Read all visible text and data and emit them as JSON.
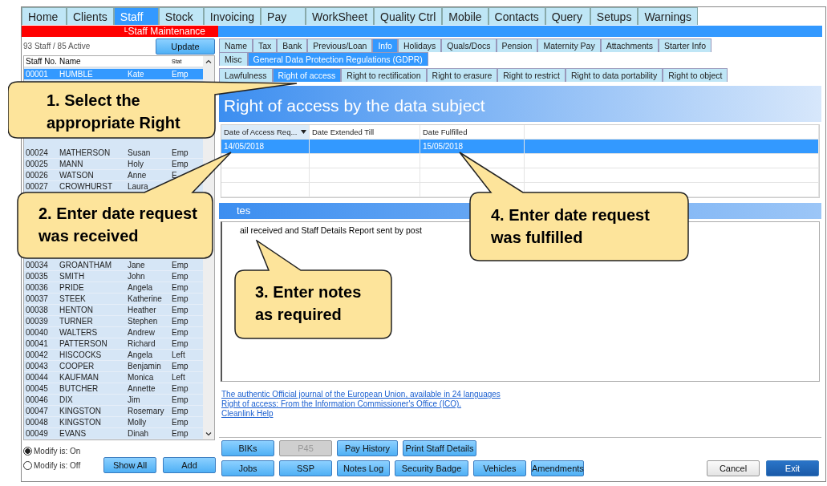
{
  "main_tabs": [
    {
      "label": "Home",
      "selected": false
    },
    {
      "label": "Clients",
      "selected": false
    },
    {
      "label": "Staff",
      "selected": true
    },
    {
      "label": "Stock",
      "selected": false
    },
    {
      "label": "Invoicing",
      "selected": false
    },
    {
      "label": "Pay",
      "selected": false
    },
    {
      "label": "WorkSheet",
      "selected": false
    },
    {
      "label": "Quality Ctrl",
      "selected": false
    },
    {
      "label": "Mobile",
      "selected": false
    },
    {
      "label": "Contacts",
      "selected": false
    },
    {
      "label": "Query",
      "selected": false
    },
    {
      "label": "Setups",
      "selected": false
    },
    {
      "label": "Warnings",
      "selected": false
    }
  ],
  "section_title": "ᴸStaff Maintenance",
  "staff_list": {
    "summary": "93 Staff / 85 Active",
    "update_button": "Update",
    "columns": [
      "Staff No.",
      "Name",
      "Stat"
    ],
    "segments": [
      [
        {
          "no": "00001",
          "surname": "HUMBLE",
          "first": "Kate",
          "status": "Emp",
          "selected": true
        }
      ],
      [
        {
          "no": "00024",
          "surname": "MATHERSON",
          "first": "Susan",
          "status": "Emp",
          "selected": false
        },
        {
          "no": "00025",
          "surname": "MANN",
          "first": "Holy",
          "status": "Emp",
          "selected": false
        },
        {
          "no": "00026",
          "surname": "WATSON",
          "first": "Anne",
          "status": "E",
          "selected": false
        },
        {
          "no": "00027",
          "surname": "CROWHURST",
          "first": "Laura",
          "selected": false
        }
      ],
      [
        {
          "no": "00034",
          "surname": "GROANTHAM",
          "first": "Jane",
          "status": "Emp",
          "selected": false
        },
        {
          "no": "00035",
          "surname": "SMITH",
          "first": "John",
          "status": "Emp",
          "selected": false
        },
        {
          "no": "00036",
          "surname": "PRIDE",
          "first": "Angela",
          "status": "Emp",
          "selected": false
        },
        {
          "no": "00037",
          "surname": "STEEK",
          "first": "Katherine",
          "status": "Emp",
          "selected": false
        },
        {
          "no": "00038",
          "surname": "HENTON",
          "first": "Heather",
          "status": "Emp",
          "selected": false
        },
        {
          "no": "00039",
          "surname": "TURNER",
          "first": "Stephen",
          "status": "Emp",
          "selected": false
        },
        {
          "no": "00040",
          "surname": "WALTERS",
          "first": "Andrew",
          "status": "Emp",
          "selected": false
        },
        {
          "no": "00041",
          "surname": "PATTERSON",
          "first": "Richard",
          "status": "Emp",
          "selected": false
        },
        {
          "no": "00042",
          "surname": "HISCOCKS",
          "first": "Angela",
          "status": "Left",
          "selected": false
        },
        {
          "no": "00043",
          "surname": "COOPER",
          "first": "Benjamin",
          "status": "Emp",
          "selected": false
        },
        {
          "no": "00044",
          "surname": "KAUFMAN",
          "first": "Monica",
          "status": "Left",
          "selected": false
        },
        {
          "no": "00045",
          "surname": "BUTCHER",
          "first": "Annette",
          "status": "Emp",
          "selected": false
        },
        {
          "no": "00046",
          "surname": "DIX",
          "first": "Jim",
          "status": "Emp",
          "selected": false
        },
        {
          "no": "00047",
          "surname": "KINGSTON",
          "first": "Rosemary",
          "status": "Emp",
          "selected": false
        },
        {
          "no": "00048",
          "surname": "KINGSTON",
          "first": "Molly",
          "status": "Emp",
          "selected": false
        },
        {
          "no": "00049",
          "surname": "EVANS",
          "first": "Dinah",
          "status": "Emp",
          "selected": false
        }
      ]
    ]
  },
  "modify_options": [
    {
      "label": "Modify is: On",
      "selected": true
    },
    {
      "label": "Modify is: Off",
      "selected": false
    }
  ],
  "left_buttons": [
    "Show All",
    "Add"
  ],
  "detail_tabs_row1": [
    {
      "label": "Name",
      "selected": false
    },
    {
      "label": "Tax",
      "selected": false
    },
    {
      "label": "Bank",
      "selected": false
    },
    {
      "label": "Previous/Loan",
      "selected": false
    },
    {
      "label": "Info",
      "selected": true
    },
    {
      "label": "Holidays",
      "selected": false
    },
    {
      "label": "Quals/Docs",
      "selected": false
    },
    {
      "label": "Pension",
      "selected": false
    },
    {
      "label": "Maternity Pay",
      "selected": false
    },
    {
      "label": "Attachments",
      "selected": false
    },
    {
      "label": "Starter Info",
      "selected": false
    }
  ],
  "detail_tabs_row2": [
    {
      "label": "Misc",
      "selected": false
    },
    {
      "label": "General Data Protection Regulations (GDPR)",
      "selected": true
    }
  ],
  "rights_tabs": [
    {
      "label": "Lawfulness",
      "selected": false
    },
    {
      "label": "Right of access",
      "selected": true
    },
    {
      "label": "Right to rectification",
      "selected": false
    },
    {
      "label": "Right to erasure",
      "selected": false
    },
    {
      "label": "Right to restrict",
      "selected": false
    },
    {
      "label": "Right to data portability",
      "selected": false
    },
    {
      "label": "Right to object",
      "selected": false
    }
  ],
  "heading": "Right of access by the data subject",
  "table": {
    "columns": [
      "Date of Access Req...",
      "Date Extended Till",
      "Date Fulfilled"
    ],
    "rows": [
      {
        "date_requested": "14/05/2018",
        "date_fulfilled": "15/05/2018",
        "selected": true
      }
    ]
  },
  "notes": {
    "title": "tes",
    "text": "ail received and Staff Details Report sent by post"
  },
  "links": [
    "The authentic Official journal of the European Union, available in 24 languages",
    "Right of access: From the Information Commissioner's Office (ICO).",
    "Cleanlink Help"
  ],
  "button_rows": [
    [
      {
        "label": "BIKs",
        "disabled": false
      },
      {
        "label": "P45",
        "disabled": true
      },
      {
        "label": "Pay History",
        "disabled": false
      },
      {
        "label": "Print Staff Details",
        "disabled": false
      }
    ],
    [
      {
        "label": "Jobs",
        "disabled": false
      },
      {
        "label": "SSP",
        "disabled": false
      },
      {
        "label": "Notes Log",
        "disabled": false
      },
      {
        "label": "Security Badge",
        "disabled": false
      },
      {
        "label": "Vehicles",
        "disabled": false
      },
      {
        "label": "Amendments",
        "disabled": false
      }
    ]
  ],
  "dialog_buttons": [
    {
      "label": "Cancel",
      "kind": "secondary"
    },
    {
      "label": "Exit",
      "kind": "primary"
    }
  ],
  "callouts": [
    "1. Select the\nappropriate Right",
    "2. Enter date request\nwas received",
    "3. Enter notes\nas required",
    "4. Enter date request\nwas fulfilled"
  ]
}
